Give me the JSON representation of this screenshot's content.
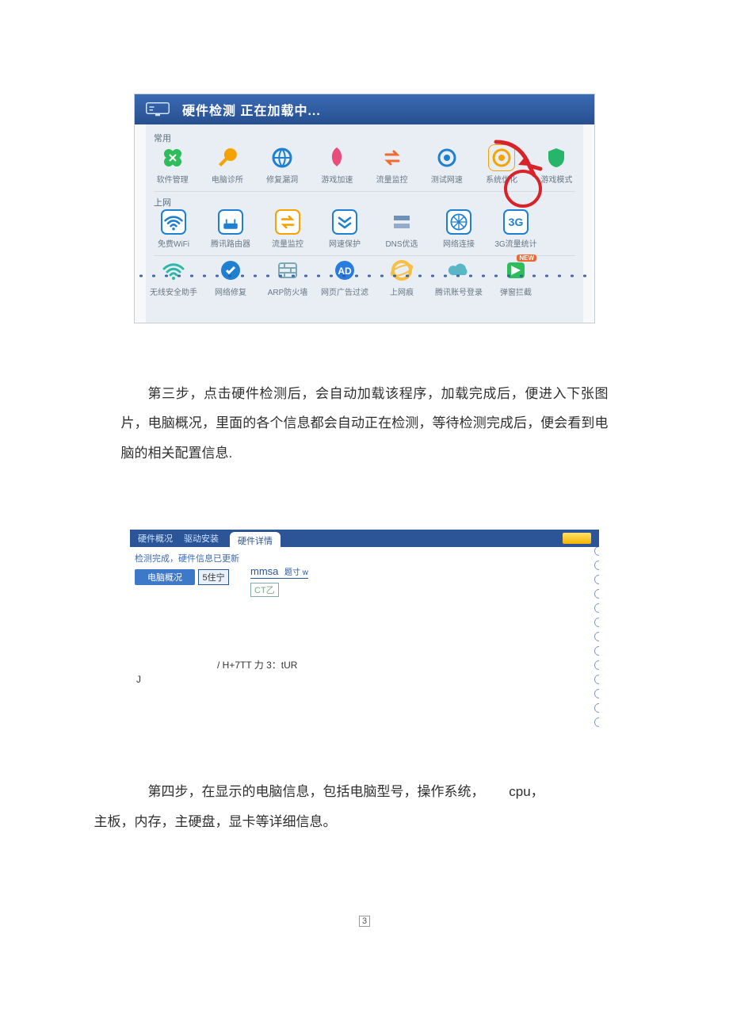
{
  "shot1": {
    "header_title": "硬件检测 正在加载中...",
    "sections": [
      {
        "label": "常用",
        "items": [
          {
            "label": "软件管理",
            "icon": "clover",
            "color": "#2fbd5c"
          },
          {
            "label": "电脑诊所",
            "icon": "wrench",
            "color": "#f5a300"
          },
          {
            "label": "修复漏洞",
            "icon": "globe",
            "color": "#1f7fd1"
          },
          {
            "label": "游戏加速",
            "icon": "rocket",
            "color": "#e94e7a"
          },
          {
            "label": "流量监控",
            "icon": "swap",
            "color": "#f06a2f"
          },
          {
            "label": "测试网速",
            "icon": "target",
            "color": "#1f7fd1"
          },
          {
            "label": "系统优化",
            "icon": "eye",
            "color": "#f5a300",
            "highlight": true
          },
          {
            "label": "游戏模式",
            "icon": "shield",
            "color": "#27b56a",
            "edge": true
          }
        ]
      },
      {
        "label": "上网",
        "items": [
          {
            "label": "免费WiFi",
            "icon": "wifi",
            "color": "#1f7fd1",
            "ring": true
          },
          {
            "label": "腾讯路由器",
            "icon": "router",
            "color": "#1f7fd1",
            "ring": true
          },
          {
            "label": "流量监控",
            "icon": "swap",
            "color": "#f5a300",
            "ring": true,
            "accent": "#f5a300"
          },
          {
            "label": "网速保护",
            "icon": "chev",
            "color": "#1f7fd1",
            "ring": true
          },
          {
            "label": "DNS优选",
            "icon": "dns",
            "color": "#6f90b7"
          },
          {
            "label": "网络连接",
            "icon": "net",
            "color": "#1f7fd1",
            "ring": true
          },
          {
            "label": "3G流量统计",
            "icon": "3g",
            "color": "#1f7fd1",
            "ring": true,
            "text": "3G"
          }
        ]
      },
      {
        "label": "",
        "items": [
          {
            "label": "无线安全助手",
            "icon": "wifi2",
            "color": "#2fb7a7"
          },
          {
            "label": "网络修复",
            "icon": "tool",
            "color": "#1f7fd1"
          },
          {
            "label": "ARP防火墙",
            "icon": "wall",
            "color": "#7aa8b7"
          },
          {
            "label": "网页广告过滤",
            "icon": "ad",
            "color": "#2a7be0"
          },
          {
            "label": "上网痕",
            "icon": "ie",
            "color": "#f5c043"
          },
          {
            "label": "腾讯账号登录",
            "icon": "cloud",
            "color": "#59b6c7"
          },
          {
            "label": "弹窗拦截",
            "icon": "flag",
            "color": "#2fbd5c",
            "badge": true
          }
        ]
      }
    ],
    "annot": {
      "name": "highlight-circle"
    }
  },
  "para1": "第三步，点击硬件检测后，会自动加载该程序，加载完成后，便进入下张图片，电脑概况，里面的各个信息都会自动正在检测，等待检测完成后，便会看到电脑的相关配置信息.",
  "shot2": {
    "tabs": [
      "硬件概况",
      "驱动安装",
      "硬件详情"
    ],
    "subtitle": "检测完成，硬件信息已更新",
    "left_pill": "电脑概况",
    "left_box": "5住宁",
    "mmsa": "mmsa",
    "mmsa_suffix": "题寸 w",
    "ctz": "CT乙",
    "midline": "/ H+7TT 力 3：tUR",
    "jchar": "J",
    "icon_r_name": "badge-icon"
  },
  "para2": {
    "line1_prefix": "第四步，在显示的电脑信息，包括电脑型号，操作系统，",
    "line1_cpu": "cpu，",
    "line2": "主板，内存，主硬盘，显卡等详细信息。"
  },
  "pagenum": "3"
}
